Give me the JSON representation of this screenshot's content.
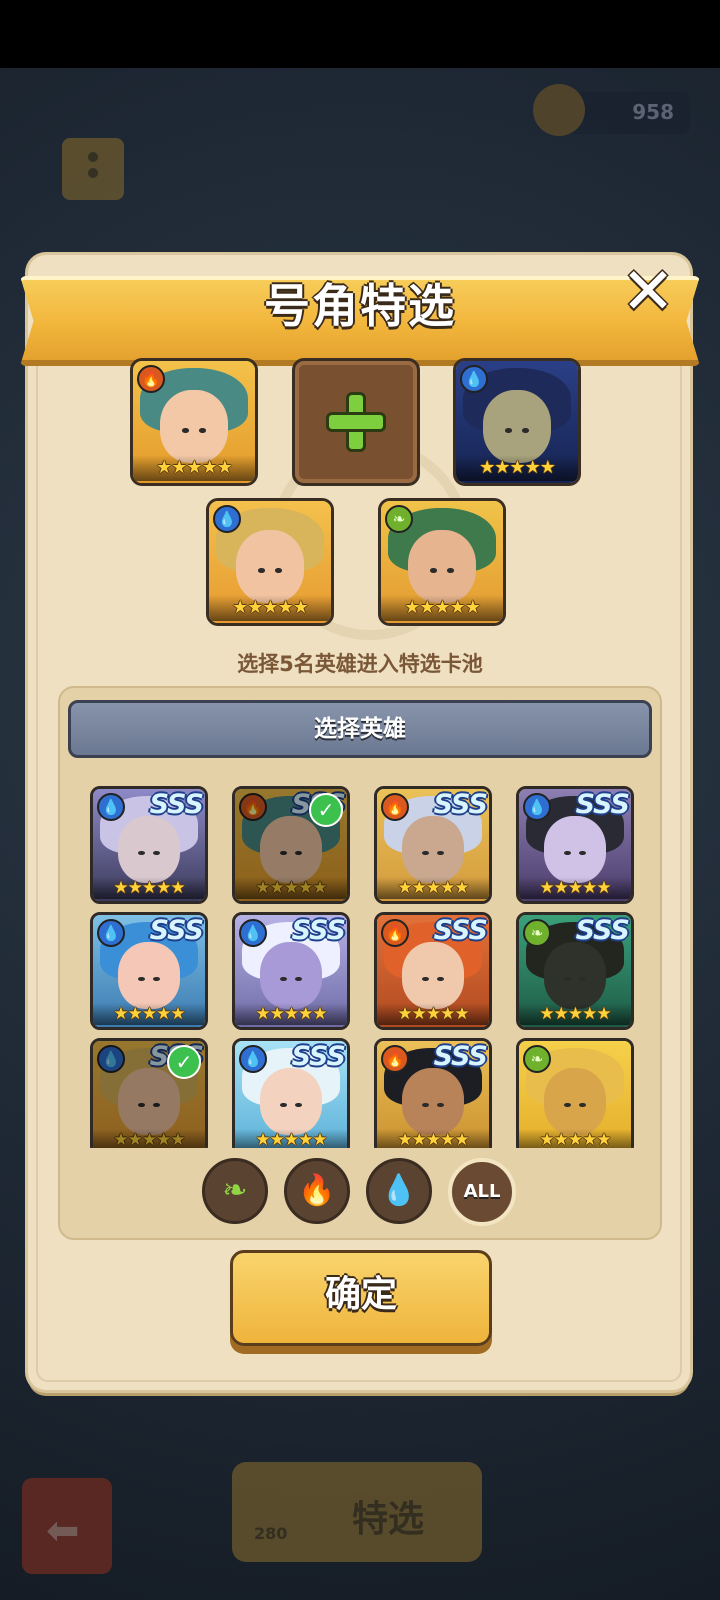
{
  "background": {
    "currency_value": "958",
    "select_button_label": "特选",
    "select_button_count": "280"
  },
  "dialog": {
    "title": "号角特选",
    "hint": "选择5名英雄进入特选卡池",
    "panel_header": "选择英雄",
    "confirm_label": "确定"
  },
  "selected_heroes": [
    {
      "element": "fire",
      "stars": "★★★★★"
    },
    {
      "element": "water",
      "stars": "★★★★★"
    },
    {
      "element": "water",
      "stars": "★★★★★"
    },
    {
      "element": "leaf",
      "stars": "★★★★★"
    }
  ],
  "hero_grid": [
    {
      "element": "water",
      "rank": "SSS",
      "stars": "★★★★★",
      "selected": false
    },
    {
      "element": "fire",
      "rank": "SSS",
      "stars": "★★★★★",
      "selected": true
    },
    {
      "element": "fire",
      "rank": "SSS",
      "stars": "★★★★★",
      "selected": false
    },
    {
      "element": "water",
      "rank": "SSS",
      "stars": "★★★★★",
      "selected": false
    },
    {
      "element": "water",
      "rank": "SSS",
      "stars": "★★★★★",
      "selected": false
    },
    {
      "element": "water",
      "rank": "SSS",
      "stars": "★★★★★",
      "selected": false
    },
    {
      "element": "fire",
      "rank": "SSS",
      "stars": "★★★★★",
      "selected": false
    },
    {
      "element": "leaf",
      "rank": "SSS",
      "stars": "★★★★★",
      "selected": false
    },
    {
      "element": "water",
      "rank": "SSS",
      "stars": "★★★★★",
      "selected": true
    },
    {
      "element": "water",
      "rank": "SSS",
      "stars": "★★★★★",
      "selected": false
    },
    {
      "element": "fire",
      "rank": "SSS",
      "stars": "★★★★★",
      "selected": false
    },
    {
      "element": "leaf",
      "rank": "",
      "stars": "★★★★★",
      "selected": false
    }
  ],
  "filters": {
    "leaf_icon": "leaf-icon",
    "fire_icon": "fire-icon",
    "water_icon": "water-drop-icon",
    "all_label": "ALL"
  },
  "colors": {
    "title_ribbon": "#f2b63c",
    "confirm_button": "#efb43c",
    "panel_header": "#7a869e",
    "fire": "#d9591f",
    "water": "#2e6fd1",
    "leaf": "#6fb12d"
  }
}
